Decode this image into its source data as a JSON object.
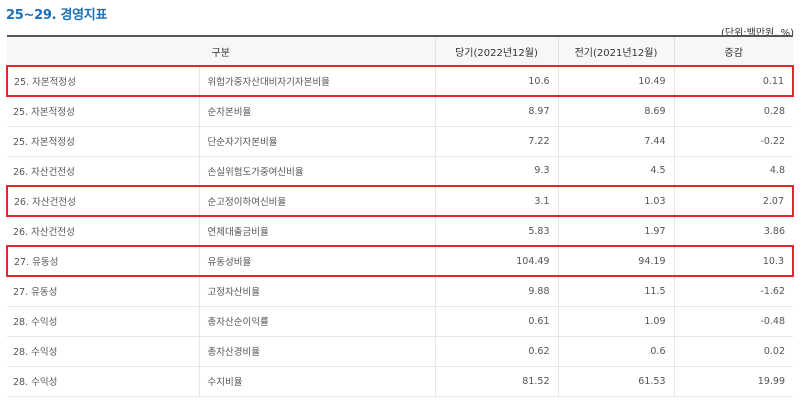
{
  "title": "25~29. 경영지표",
  "unit": "(단위:백만원, %)",
  "headers": [
    "구분",
    "당기(2022년12월)",
    "전기(2021년12월)",
    "증감"
  ],
  "highlight_color": "#e3262e",
  "title_color": "#1a6fb5",
  "rows": [
    {
      "category": "25. 자본적정성",
      "item": "위험가중자산대비자기자본비율",
      "current": "10.6",
      "previous": "10.49",
      "change": "0.11",
      "highlighted": true
    },
    {
      "category": "25. 자본적정성",
      "item": "순자본비율",
      "current": "8.97",
      "previous": "8.69",
      "change": "0.28",
      "highlighted": false
    },
    {
      "category": "25. 자본적정성",
      "item": "단순자기자본비율",
      "current": "7.22",
      "previous": "7.44",
      "change": "-0.22",
      "highlighted": false
    },
    {
      "category": "26. 자산건전성",
      "item": "손실위험도가중여신비율",
      "current": "9.3",
      "previous": "4.5",
      "change": "4.8",
      "highlighted": false
    },
    {
      "category": "26. 자산건전성",
      "item": "순고정이하여신비율",
      "current": "3.1",
      "previous": "1.03",
      "change": "2.07",
      "highlighted": true
    },
    {
      "category": "26. 자산건전성",
      "item": "연체대출금비율",
      "current": "5.83",
      "previous": "1.97",
      "change": "3.86",
      "highlighted": false
    },
    {
      "category": "27. 유동성",
      "item": "유동성비율",
      "current": "104.49",
      "previous": "94.19",
      "change": "10.3",
      "highlighted": true
    },
    {
      "category": "27. 유동성",
      "item": "고정자산비율",
      "current": "9.88",
      "previous": "11.5",
      "change": "-1.62",
      "highlighted": false
    },
    {
      "category": "28. 수익성",
      "item": "총자산순이익률",
      "current": "0.61",
      "previous": "1.09",
      "change": "-0.48",
      "highlighted": false
    },
    {
      "category": "28. 수익성",
      "item": "총자산경비율",
      "current": "0.62",
      "previous": "0.6",
      "change": "0.02",
      "highlighted": false
    },
    {
      "category": "28. 수익성",
      "item": "수지비율",
      "current": "81.52",
      "previous": "61.53",
      "change": "19.99",
      "highlighted": false
    }
  ]
}
